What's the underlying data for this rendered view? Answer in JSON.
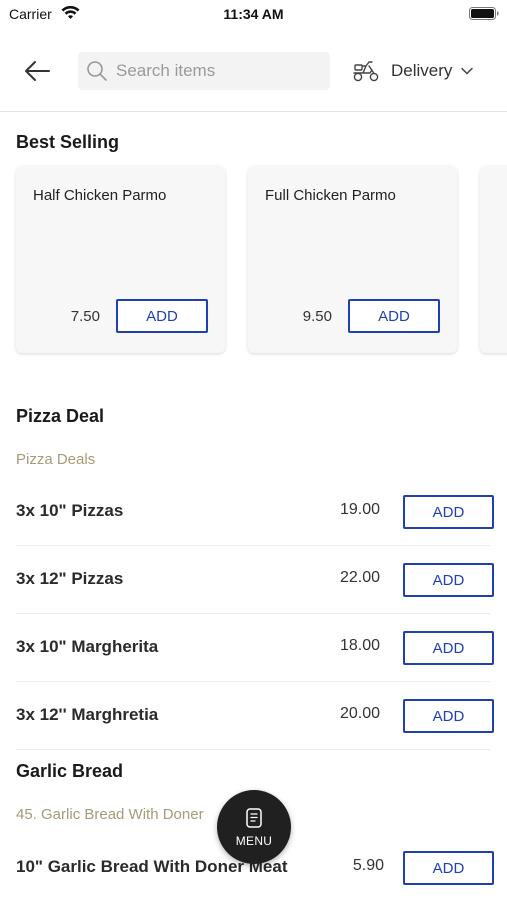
{
  "status_bar": {
    "carrier": "Carrier",
    "time": "11:34 AM"
  },
  "header": {
    "search_placeholder": "Search items",
    "delivery_label": "Delivery"
  },
  "best_selling": {
    "title": "Best Selling",
    "cards": [
      {
        "name": "Half Chicken Parmo",
        "price": "7.50",
        "add_label": "ADD"
      },
      {
        "name": "Full Chicken Parmo",
        "price": "9.50",
        "add_label": "ADD"
      }
    ]
  },
  "pizza_deal": {
    "title": "Pizza Deal",
    "category": "Pizza Deals",
    "items": [
      {
        "name": "3x 10\" Pizzas",
        "price": "19.00",
        "add_label": "ADD"
      },
      {
        "name": "3x 12\" Pizzas",
        "price": "22.00",
        "add_label": "ADD"
      },
      {
        "name": "3x 10\" Margherita",
        "price": "18.00",
        "add_label": "ADD"
      },
      {
        "name": "3x 12'' Marghretia",
        "price": "20.00",
        "add_label": "ADD"
      }
    ]
  },
  "garlic_bread": {
    "title": "Garlic Bread",
    "category": "45. Garlic Bread With Doner",
    "items": [
      {
        "name": "10\" Garlic Bread With Doner Meat",
        "price": "5.90",
        "add_label": "ADD"
      }
    ]
  },
  "menu_button": {
    "label": "MENU"
  },
  "colors": {
    "accent": "#1f3fb5",
    "category_text": "#a89a78",
    "fab_background": "#202020"
  }
}
